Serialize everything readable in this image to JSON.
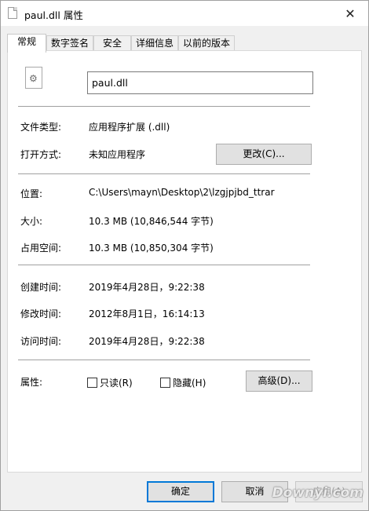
{
  "window": {
    "title": "paul.dll 属性",
    "close_glyph": "✕"
  },
  "tabs": [
    {
      "label": "常规",
      "active": true
    },
    {
      "label": "数字签名"
    },
    {
      "label": "安全"
    },
    {
      "label": "详细信息"
    },
    {
      "label": "以前的版本"
    }
  ],
  "general": {
    "file_name": "paul.dll",
    "file_type_label": "文件类型:",
    "file_type_value": "应用程序扩展 (.dll)",
    "opens_with_label": "打开方式:",
    "opens_with_value": "未知应用程序",
    "change_button": "更改(C)...",
    "location_label": "位置:",
    "location_value": "C:\\Users\\mayn\\Desktop\\2\\lzgjpjbd_ttrar",
    "size_label": "大小:",
    "size_value": "10.3 MB (10,846,544 字节)",
    "size_on_disk_label": "占用空间:",
    "size_on_disk_value": "10.3 MB (10,850,304 字节)",
    "created_label": "创建时间:",
    "created_value": "2019年4月28日，9:22:38",
    "modified_label": "修改时间:",
    "modified_value": "2012年8月1日，16:14:13",
    "accessed_label": "访问时间:",
    "accessed_value": "2019年4月28日，9:22:38",
    "attributes_label": "属性:",
    "readonly_label": "只读(R)",
    "hidden_label": "隐藏(H)",
    "advanced_button": "高级(D)..."
  },
  "footer": {
    "ok_button": "确定",
    "cancel_button": "取消",
    "apply_button": "应用(A)"
  },
  "watermark": "Downyi.com",
  "colors": {
    "accent": "#0078d7",
    "panel_bg": "#ffffff",
    "window_bg": "#f0f0f0"
  },
  "icons": {
    "window_icon": "file-icon",
    "file_icon": "dll-gear-file-icon"
  }
}
